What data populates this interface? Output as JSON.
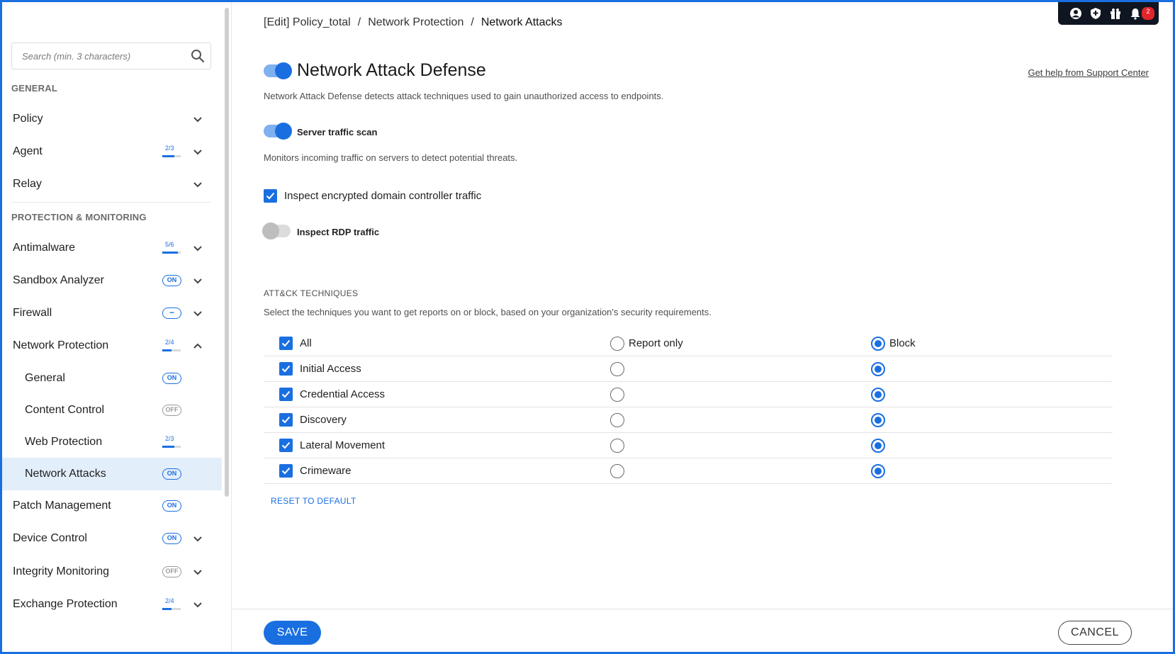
{
  "search": {
    "placeholder": "Search (min. 3 characters)"
  },
  "sidebar": {
    "general_label": "GENERAL",
    "protection_label": "PROTECTION & MONITORING",
    "items": [
      {
        "label": "Policy"
      },
      {
        "label": "Agent",
        "ratio": "2/3",
        "fraction": 0.67
      },
      {
        "label": "Relay"
      },
      {
        "label": "Antimalware",
        "ratio": "5/6",
        "fraction": 0.83
      },
      {
        "label": "Sandbox Analyzer",
        "badge": "ON"
      },
      {
        "label": "Firewall",
        "badge": "−"
      },
      {
        "label": "Network Protection",
        "ratio": "2/4",
        "fraction": 0.5
      },
      {
        "label": "General",
        "badge": "ON"
      },
      {
        "label": "Content Control",
        "badge": "OFF"
      },
      {
        "label": "Web Protection",
        "ratio": "2/3",
        "fraction": 0.67
      },
      {
        "label": "Network Attacks",
        "badge": "ON"
      },
      {
        "label": "Patch Management",
        "badge": "ON"
      },
      {
        "label": "Device Control",
        "badge": "ON"
      },
      {
        "label": "Integrity Monitoring",
        "badge": "OFF"
      },
      {
        "label": "Exchange Protection",
        "ratio": "2/4",
        "fraction": 0.5
      }
    ]
  },
  "breadcrumb": {
    "items": [
      "[Edit] Policy_total",
      "Network Protection",
      "Network Attacks"
    ],
    "separator": "/"
  },
  "header": {
    "notification_count": "2"
  },
  "page": {
    "title": "Network Attack Defense",
    "title_toggle": "on",
    "help_link": "Get help from Support Center",
    "description": "Network Attack Defense detects attack techniques used to gain unauthorized access to endpoints."
  },
  "options": {
    "server_traffic_scan": {
      "label": "Server traffic scan",
      "state": "on",
      "description": "Monitors incoming traffic on servers to detect potential threats."
    },
    "inspect_encrypted": {
      "label": "Inspect encrypted domain controller traffic",
      "checked": true
    },
    "inspect_rdp": {
      "label": "Inspect RDP traffic",
      "state": "off"
    }
  },
  "techniques": {
    "heading": "ATT&CK TECHNIQUES",
    "description": "Select the techniques you want to get reports on or block, based on your organization's security requirements.",
    "columns": {
      "all": "All",
      "report": "Report only",
      "block": "Block"
    },
    "rows": [
      {
        "name": "Initial Access",
        "checked": true,
        "action": "block"
      },
      {
        "name": "Credential Access",
        "checked": true,
        "action": "block"
      },
      {
        "name": "Discovery",
        "checked": true,
        "action": "block"
      },
      {
        "name": "Lateral Movement",
        "checked": true,
        "action": "block"
      },
      {
        "name": "Crimeware",
        "checked": true,
        "action": "block"
      }
    ],
    "reset_label": "RESET TO DEFAULT"
  },
  "footer": {
    "save_label": "SAVE",
    "cancel_label": "CANCEL"
  },
  "colors": {
    "accent": "#1a6fe0",
    "active_nav_bg": "#e3eefb",
    "notification": "#e0252b"
  }
}
